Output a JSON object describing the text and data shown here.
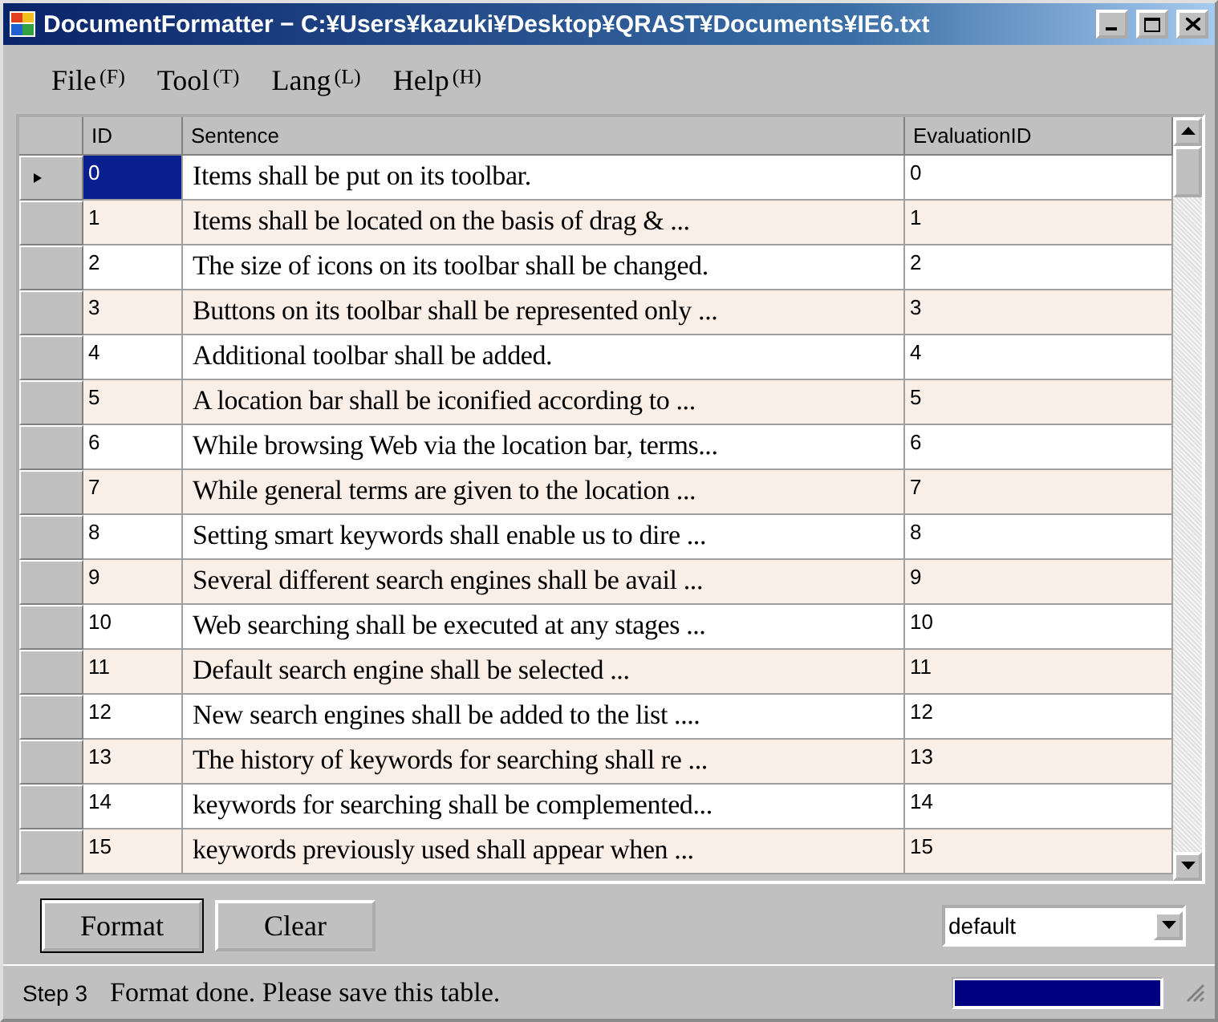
{
  "window": {
    "title": "DocumentFormatter − C:¥Users¥kazuki¥Desktop¥QRAST¥Documents¥IE6.txt"
  },
  "menu": [
    {
      "label": "File",
      "key": "(F)"
    },
    {
      "label": "Tool",
      "key": "(T)"
    },
    {
      "label": "Lang",
      "key": "(L)"
    },
    {
      "label": "Help",
      "key": "(H)"
    }
  ],
  "table": {
    "columns": [
      "ID",
      "Sentence",
      "EvaluationID"
    ],
    "rows": [
      {
        "id": "0",
        "sentence": "Items shall be put on its toolbar.",
        "evaluation_id": "0",
        "selected": true
      },
      {
        "id": "1",
        "sentence": "Items shall be located on the basis of drag & ...",
        "evaluation_id": "1",
        "selected": false
      },
      {
        "id": "2",
        "sentence": "The size of icons on its toolbar shall be changed.",
        "evaluation_id": "2",
        "selected": false
      },
      {
        "id": "3",
        "sentence": "Buttons on its toolbar shall be represented only ...",
        "evaluation_id": "3",
        "selected": false
      },
      {
        "id": "4",
        "sentence": "Additional toolbar shall be added.",
        "evaluation_id": "4",
        "selected": false
      },
      {
        "id": "5",
        "sentence": "A location bar shall be iconified according to ...",
        "evaluation_id": "5",
        "selected": false
      },
      {
        "id": "6",
        "sentence": "While browsing Web via the location bar, terms...",
        "evaluation_id": "6",
        "selected": false
      },
      {
        "id": "7",
        "sentence": "While general terms are given to the location ...",
        "evaluation_id": "7",
        "selected": false
      },
      {
        "id": "8",
        "sentence": "Setting smart keywords shall enable us to dire ...",
        "evaluation_id": "8",
        "selected": false
      },
      {
        "id": "9",
        "sentence": "Several different search engines shall be avail ...",
        "evaluation_id": "9",
        "selected": false
      },
      {
        "id": "10",
        "sentence": "Web searching shall be executed at any stages ...",
        "evaluation_id": "10",
        "selected": false
      },
      {
        "id": "11",
        "sentence": "Default search engine shall be selected ...",
        "evaluation_id": "11",
        "selected": false
      },
      {
        "id": "12",
        "sentence": "New search engines shall be added to the list ....",
        "evaluation_id": "12",
        "selected": false
      },
      {
        "id": "13",
        "sentence": "The history of keywords for searching shall re ...",
        "evaluation_id": "13",
        "selected": false
      },
      {
        "id": "14",
        "sentence": "keywords for searching shall be complemented...",
        "evaluation_id": "14",
        "selected": false
      },
      {
        "id": "15",
        "sentence": "keywords previously used shall appear when ...",
        "evaluation_id": "15",
        "selected": false
      }
    ]
  },
  "buttons": [
    "Format",
    "Clear"
  ],
  "dropdown": {
    "value": "default"
  },
  "status_bar": {
    "step": "Step 3",
    "message": "Format done. Please save this table.",
    "progress": {
      "level": 1
    }
  }
}
